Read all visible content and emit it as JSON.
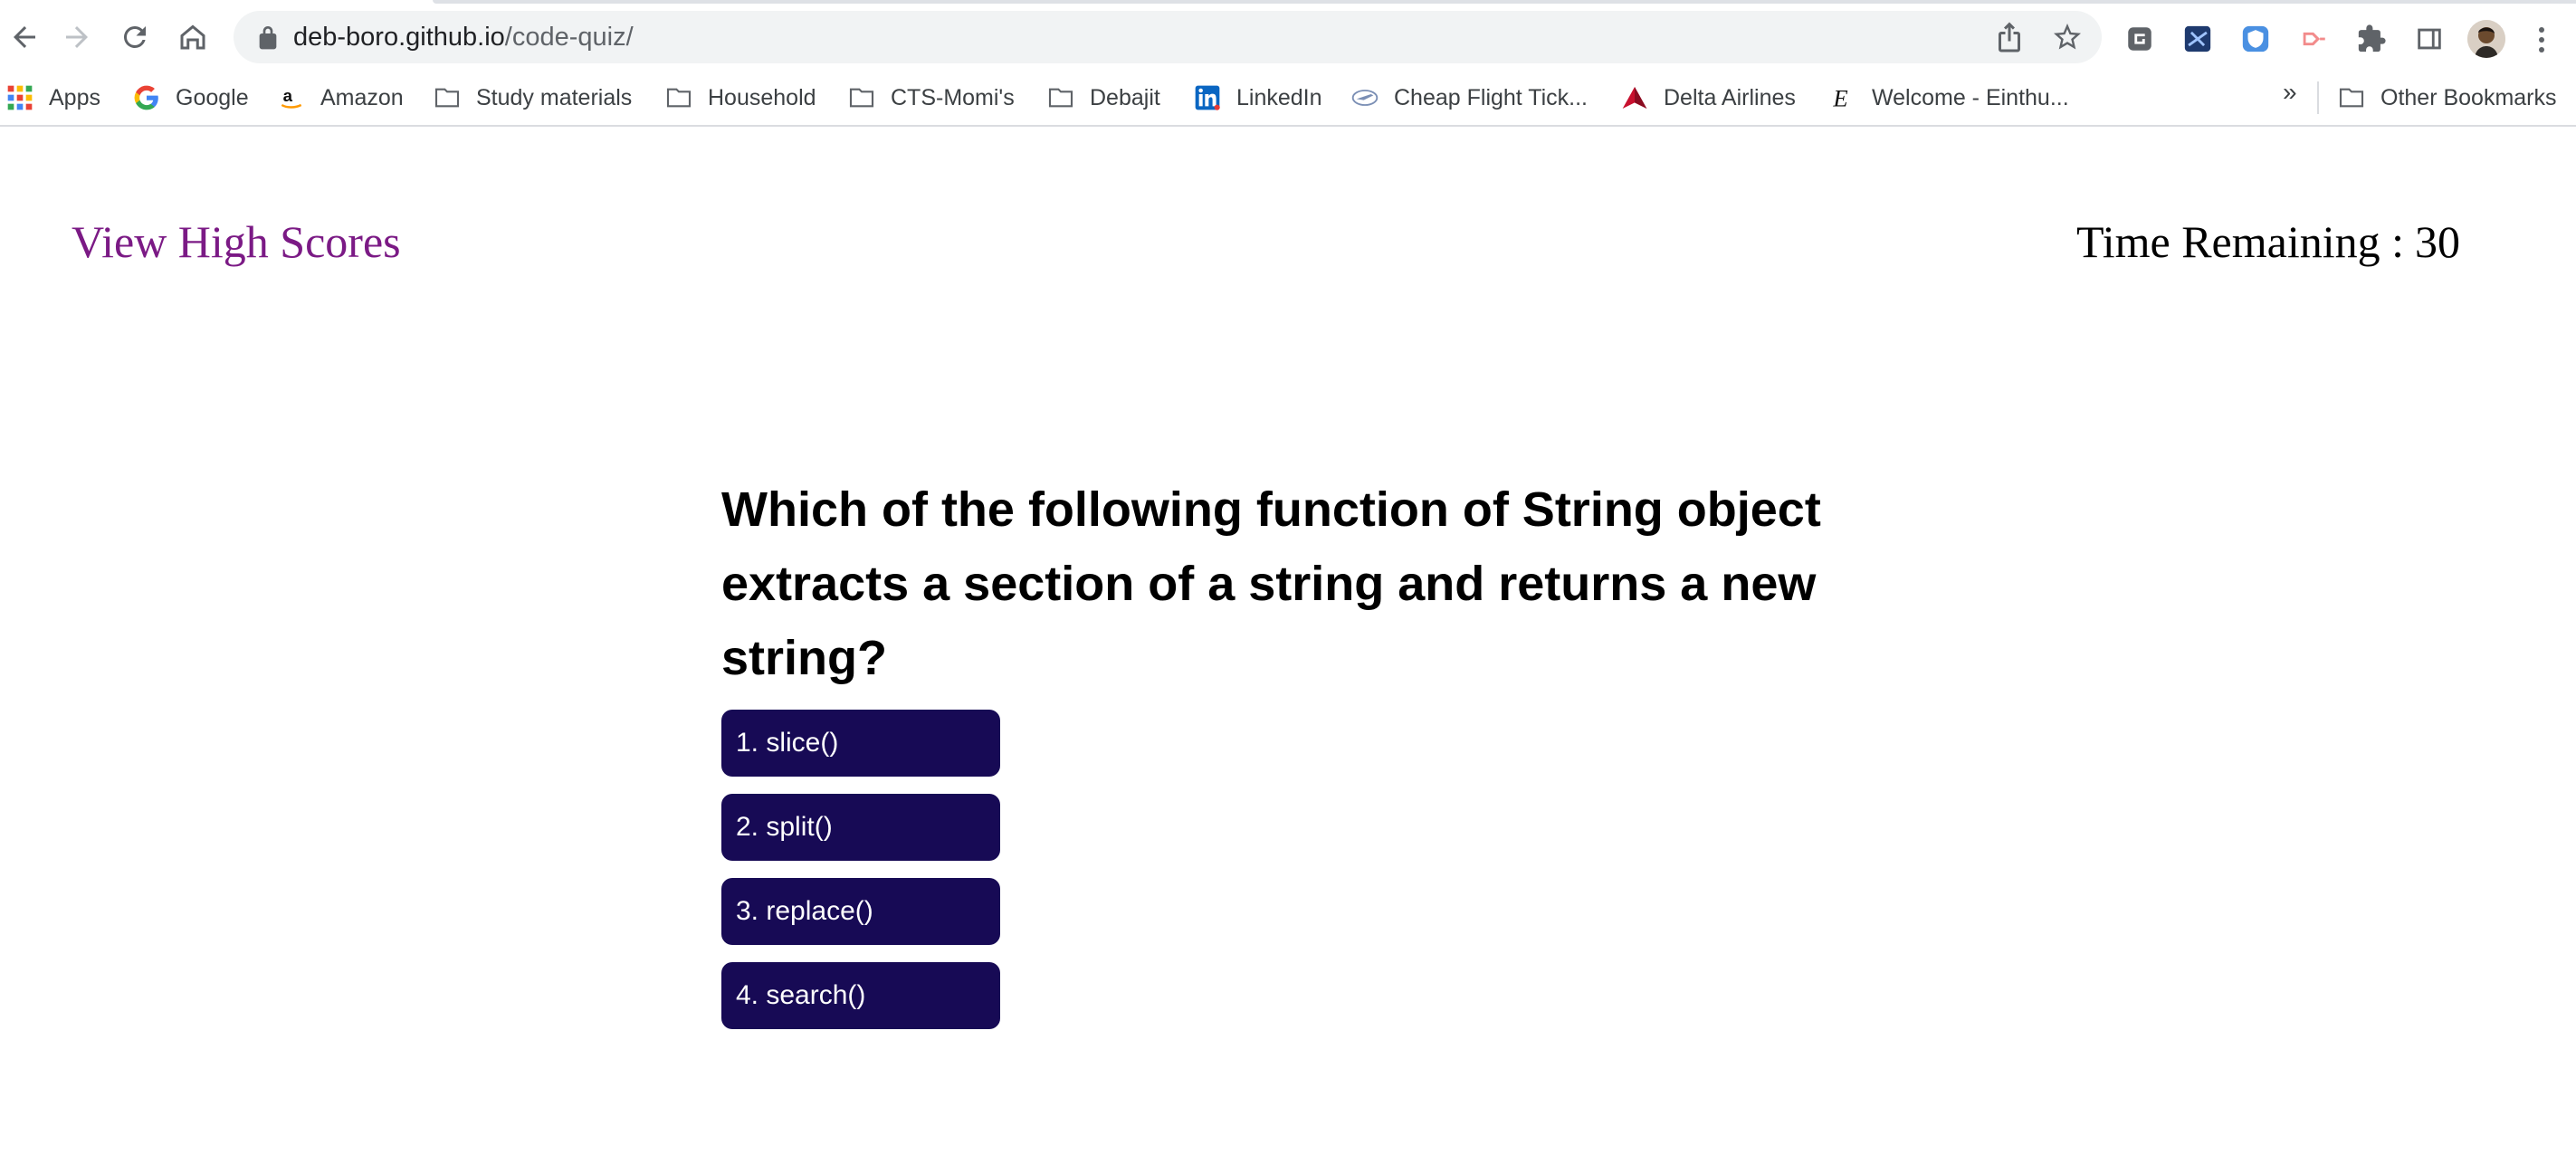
{
  "browser": {
    "url_host": "deb-boro.github.io",
    "url_path": "/code-quiz/",
    "nav": {
      "back_icon": "arrow-left-icon",
      "forward_icon": "arrow-right-icon",
      "reload_icon": "reload-icon",
      "home_icon": "home-icon"
    },
    "omnibox_icons": [
      "lock-icon",
      "share-icon",
      "star-icon"
    ],
    "extensions": [
      "extension-grammar-icon",
      "extension-blue-icon",
      "extension-shield-icon",
      "extension-cast-icon",
      "puzzle-icon",
      "sidepanel-icon"
    ],
    "bookmarks": [
      {
        "label": "Apps",
        "icon": "apps-grid-icon"
      },
      {
        "label": "Google",
        "icon": "google-icon"
      },
      {
        "label": "Amazon",
        "icon": "amazon-icon"
      },
      {
        "label": "Study materials",
        "icon": "folder-icon"
      },
      {
        "label": "Household",
        "icon": "folder-icon"
      },
      {
        "label": "CTS-Momi's",
        "icon": "folder-icon"
      },
      {
        "label": "Debajit",
        "icon": "folder-icon"
      },
      {
        "label": "LinkedIn",
        "icon": "linkedin-icon"
      },
      {
        "label": "Cheap Flight Tick...",
        "icon": "plane-icon"
      },
      {
        "label": "Delta Airlines",
        "icon": "delta-icon"
      },
      {
        "label": "Welcome - Einthu...",
        "icon": "einthusan-icon"
      }
    ],
    "overflow_label": "»",
    "other_bookmarks_label": "Other Bookmarks",
    "colors": {
      "toolbar_bg": "#ffffff",
      "omnibox_bg": "#f1f3f4"
    }
  },
  "page": {
    "high_scores_link": "View High Scores",
    "timer_label": "Time Remaining :",
    "timer_value": "30",
    "question": "Which of the following function of String object extracts a section of a string and returns a new string?",
    "answers": [
      "1. slice()",
      "2. split()",
      "3. replace()",
      "4. search()"
    ],
    "colors": {
      "link": "#7b1a85",
      "button_bg": "#170a55",
      "button_text": "#ffffff"
    }
  }
}
